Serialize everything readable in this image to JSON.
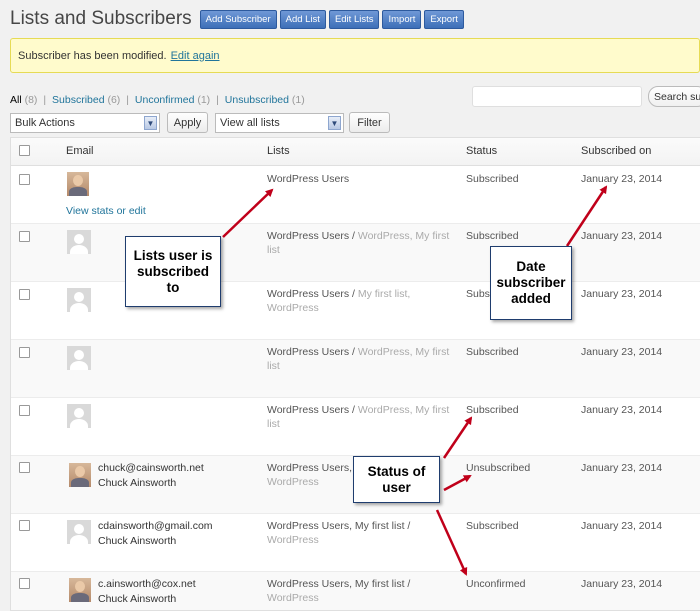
{
  "header": {
    "title": "Lists and Subscribers",
    "buttons": [
      "Add Subscriber",
      "Add List",
      "Edit Lists",
      "Import",
      "Export"
    ]
  },
  "notice": {
    "message": "Subscriber has been modified.",
    "link": "Edit again"
  },
  "filters": {
    "all": "All",
    "all_count": "(8)",
    "subscribed": "Subscribed",
    "subscribed_count": "(6)",
    "unconfirmed": "Unconfirmed",
    "unconfirmed_count": "(1)",
    "unsubscribed": "Unsubscribed",
    "unsubscribed_count": "(1)"
  },
  "search": {
    "value": "",
    "button": "Search su"
  },
  "bulk": {
    "action": "Bulk Actions",
    "apply": "Apply",
    "view": "View all lists",
    "filter": "Filter"
  },
  "table": {
    "columns": [
      "Email",
      "Lists",
      "Status",
      "Subscribed on"
    ],
    "rows": [
      {
        "avatar": "photo",
        "email": "",
        "name": "",
        "link": "View stats or edit",
        "lists_main": "WordPress Users",
        "lists_faded": "",
        "lists_line2": "",
        "status": "Subscribed",
        "date": "January 23, 2014"
      },
      {
        "avatar": "gray",
        "email": "",
        "name": "",
        "link": "",
        "lists_main": "WordPress Users /",
        "lists_faded": "WordPress, My first",
        "lists_line2": "list",
        "status": "Subscribed",
        "date": "January 23, 2014"
      },
      {
        "avatar": "gray",
        "email": "",
        "name": "",
        "link": "",
        "lists_main": "WordPress Users /",
        "lists_faded": "My first list,",
        "lists_line2": "WordPress",
        "status": "Subsc",
        "date": "January 23, 2014"
      },
      {
        "avatar": "gray",
        "email": "",
        "name": "",
        "link": "",
        "lists_main": "WordPress Users /",
        "lists_faded": "WordPress, My first",
        "lists_line2": "list",
        "status": "Subscribed",
        "date": "January 23, 2014"
      },
      {
        "avatar": "gray",
        "email": "",
        "name": "",
        "link": "",
        "lists_main": "WordPress Users /",
        "lists_faded": "WordPress, My first",
        "lists_line2": "list",
        "status": "Subscribed",
        "date": "January 23, 2014"
      },
      {
        "avatar": "photo",
        "email": "chuck@cainsworth.net",
        "name": "Chuck Ainsworth",
        "link": "",
        "lists_main": "WordPress Users,",
        "lists_faded": "",
        "lists_line2": "WordPress",
        "status": "Unsubscribed",
        "date": "January 23, 2014"
      },
      {
        "avatar": "gray",
        "email": "cdainsworth@gmail.com",
        "name": "Chuck Ainsworth",
        "link": "",
        "lists_main": "WordPress Users, My first list /",
        "lists_faded": "",
        "lists_line2": "WordPress",
        "status": "Subscribed",
        "date": "January 23, 2014"
      },
      {
        "avatar": "photo",
        "email": "c.ainsworth@cox.net",
        "name": "Chuck Ainsworth",
        "link": "",
        "lists_main": "WordPress Users, My first list /",
        "lists_faded": "",
        "lists_line2": "WordPress",
        "status": "Unconfirmed",
        "date": "January 23, 2014"
      }
    ]
  },
  "callouts": {
    "lists": "Lists user is subscribed to",
    "date": "Date subscriber added",
    "status": "Status of user"
  },
  "colors": {
    "arrow": "#c0001a",
    "button": "#3d6fb8",
    "link": "#21759b",
    "notice_bg": "#fffbcc"
  }
}
